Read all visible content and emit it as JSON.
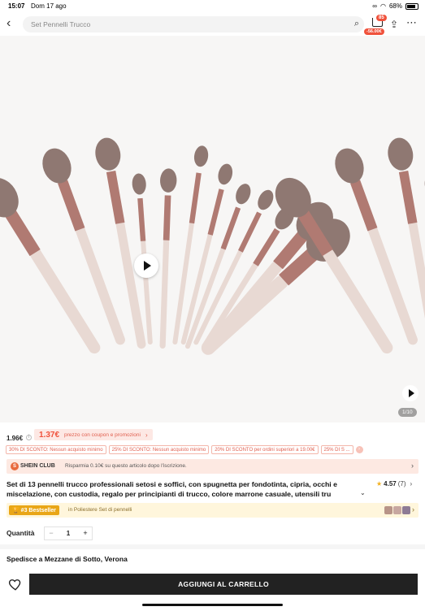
{
  "status": {
    "time": "15:07",
    "date": "Dom 17 ago",
    "battery": "68%",
    "battery_level": 0.68
  },
  "header": {
    "search_placeholder": "Set Pennelli Trucco",
    "cart_badge": "85",
    "cart_price": "-56.00€"
  },
  "gallery": {
    "page_indicator": "1/10"
  },
  "price": {
    "current": "1.96€",
    "coupon_price": "1.37€",
    "coupon_text": "prezzo con coupon e promozioni"
  },
  "discounts": [
    "30% DI SCONTO: Nessun acquisto minimo",
    "25% DI SCONTO: Nessun acquisto minimo",
    "20% DI SCONTO per ordini superiori a 19.00€",
    "25% DI S ..."
  ],
  "club": {
    "name": "SHEIN CLUB",
    "text": "Risparmia 0.10€ su questo articolo dopo l'iscrizione."
  },
  "product": {
    "title": "Set di 13 pennelli trucco professionali setosi e soffici, con spugnetta per fondotinta, cipria, occhi e miscelazione, con custodia, regalo per principianti di trucco, colore marrone casuale, utensili tru",
    "rating": "4.57",
    "rating_count": "(7)"
  },
  "bestseller": {
    "badge": "#3 Bestseller",
    "text": "in Poliestere Set di pennelli"
  },
  "quantity": {
    "label": "Quantità",
    "minus": "−",
    "value": "1",
    "plus": "+"
  },
  "shipping": {
    "text": "Spedisce a Mezzane di Sotto, Verona"
  },
  "actions": {
    "add_to_cart": "AGGIUNGI AL CARRELLO"
  },
  "colors": {
    "accent": "#f0523c",
    "gold": "#e9a617",
    "brush_handle": "#e8d9d3",
    "ferrule": "#b07a72",
    "bristles": "#8f7872"
  }
}
